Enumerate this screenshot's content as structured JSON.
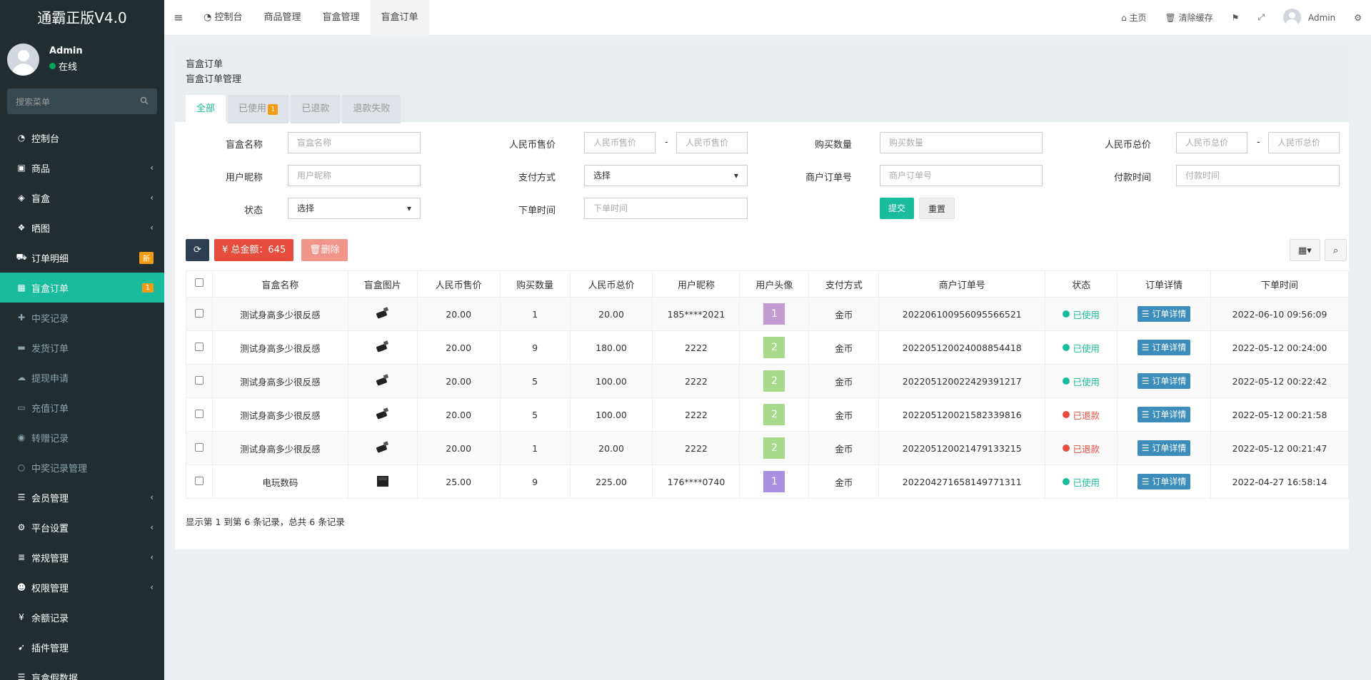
{
  "app": {
    "title": "通霸正版V4.0"
  },
  "user": {
    "name": "Admin",
    "status": "在线"
  },
  "sidebar": {
    "search_placeholder": "搜索菜单",
    "items": [
      {
        "label": "控制台",
        "icon": "dashboard-icon"
      },
      {
        "label": "商品",
        "icon": "shopping-bag-icon"
      },
      {
        "label": "盲盒",
        "icon": "cube-icon"
      },
      {
        "label": "晒图",
        "icon": "dropbox-icon"
      },
      {
        "label": "订单明细",
        "icon": "cart-icon",
        "badge": "新"
      },
      {
        "label": "盲盒订单",
        "icon": "calendar-icon",
        "badge": "1"
      },
      {
        "label": "中奖记录",
        "icon": "gift-icon"
      },
      {
        "label": "发货订单",
        "icon": "truck-icon"
      },
      {
        "label": "提现申请",
        "icon": "comments-icon"
      },
      {
        "label": "充值订单",
        "icon": "credit-card-icon"
      },
      {
        "label": "转赠记录",
        "icon": "eye-icon"
      },
      {
        "label": "中奖记录管理",
        "icon": "circle-icon"
      },
      {
        "label": "会员管理",
        "icon": "list-icon"
      },
      {
        "label": "平台设置",
        "icon": "gear-icon"
      },
      {
        "label": "常规管理",
        "icon": "database-icon"
      },
      {
        "label": "权限管理",
        "icon": "group-icon"
      },
      {
        "label": "余额记录",
        "icon": "yen-icon"
      },
      {
        "label": "插件管理",
        "icon": "rocket-icon"
      },
      {
        "label": "盲盒假数据",
        "icon": "list-icon"
      }
    ]
  },
  "navbar": {
    "tabs": [
      "控制台",
      "商品管理",
      "盲盒管理",
      "盲盒订单"
    ],
    "home": "主页",
    "clear_cache": "清除缓存",
    "user": "Admin"
  },
  "page": {
    "title": "盲盒订单",
    "subtitle": "盲盒订单管理",
    "tabs": [
      {
        "label": "全部"
      },
      {
        "label": "已使用",
        "badge": "1"
      },
      {
        "label": "已退款"
      },
      {
        "label": "退款失败"
      }
    ]
  },
  "filters": {
    "box_name": {
      "label": "盲盒名称",
      "placeholder": "盲盒名称"
    },
    "rmb_price": {
      "label": "人民币售价",
      "placeholder1": "人民币售价",
      "placeholder2": "人民币售价"
    },
    "qty": {
      "label": "购买数量",
      "placeholder": "购买数量"
    },
    "rmb_total": {
      "label": "人民币总价",
      "placeholder1": "人民币总价",
      "placeholder2": "人民币总价"
    },
    "nickname": {
      "label": "用户昵称",
      "placeholder": "用户昵称"
    },
    "pay_method": {
      "label": "支付方式",
      "value": "选择"
    },
    "merchant_no": {
      "label": "商户订单号",
      "placeholder": "商户订单号"
    },
    "pay_time": {
      "label": "付款时间",
      "placeholder": "付款时间"
    },
    "status": {
      "label": "状态",
      "value": "选择"
    },
    "order_time": {
      "label": "下单时间",
      "placeholder": "下单时间"
    },
    "submit": "提交",
    "reset": "重置"
  },
  "toolbar": {
    "total": "¥ 总金额：645",
    "delete": "删除"
  },
  "table": {
    "columns": [
      "盲盒名称",
      "盲盒图片",
      "人民币售价",
      "购买数量",
      "人民币总价",
      "用户昵称",
      "用户头像",
      "支付方式",
      "商户订单号",
      "状态",
      "订单详情",
      "下单时间"
    ],
    "detail_label": "订单详情",
    "rows": [
      {
        "name": "测试身高多少很反感",
        "price": "20.00",
        "qty": "1",
        "total": "20.00",
        "nick": "185****2021",
        "avatar": "1",
        "avatar_color": "#c39bd3",
        "pay": "金币",
        "order_no": "202206100956095566521",
        "status": "已使用",
        "status_color": "#18bc9c",
        "time": "2022-06-10 09:56:09",
        "img": "usb"
      },
      {
        "name": "测试身高多少很反感",
        "price": "20.00",
        "qty": "9",
        "total": "180.00",
        "nick": "2222",
        "avatar": "2",
        "avatar_color": "#a9d98b",
        "pay": "金币",
        "order_no": "202205120024008854418",
        "status": "已使用",
        "status_color": "#18bc9c",
        "time": "2022-05-12 00:24:00",
        "img": "usb"
      },
      {
        "name": "测试身高多少很反感",
        "price": "20.00",
        "qty": "5",
        "total": "100.00",
        "nick": "2222",
        "avatar": "2",
        "avatar_color": "#a9d98b",
        "pay": "金币",
        "order_no": "202205120022429391217",
        "status": "已使用",
        "status_color": "#18bc9c",
        "time": "2022-05-12 00:22:42",
        "img": "usb"
      },
      {
        "name": "测试身高多少很反感",
        "price": "20.00",
        "qty": "5",
        "total": "100.00",
        "nick": "2222",
        "avatar": "2",
        "avatar_color": "#a9d98b",
        "pay": "金币",
        "order_no": "202205120021582339816",
        "status": "已退款",
        "status_color": "#e74c3c",
        "time": "2022-05-12 00:21:58",
        "img": "usb"
      },
      {
        "name": "测试身高多少很反感",
        "price": "20.00",
        "qty": "1",
        "total": "20.00",
        "nick": "2222",
        "avatar": "2",
        "avatar_color": "#a9d98b",
        "pay": "金币",
        "order_no": "202205120021479133215",
        "status": "已退款",
        "status_color": "#e74c3c",
        "time": "2022-05-12 00:21:47",
        "img": "usb"
      },
      {
        "name": "电玩数码",
        "price": "25.00",
        "qty": "9",
        "total": "225.00",
        "nick": "176****0740",
        "avatar": "1",
        "avatar_color": "#a98fe0",
        "pay": "金币",
        "order_no": "202204271658149771311",
        "status": "已使用",
        "status_color": "#18bc9c",
        "time": "2022-04-27 16:58:14",
        "img": "box"
      }
    ]
  },
  "pagination": {
    "info": "显示第 1 到第 6 条记录，总共 6 条记录"
  },
  "colors": {
    "accent": "#18bc9c",
    "sidebar_bg": "#222d32",
    "danger": "#e74c3c",
    "primary": "#3c8dbc",
    "dark_btn": "#2c3e50",
    "warning": "#f39c12"
  }
}
